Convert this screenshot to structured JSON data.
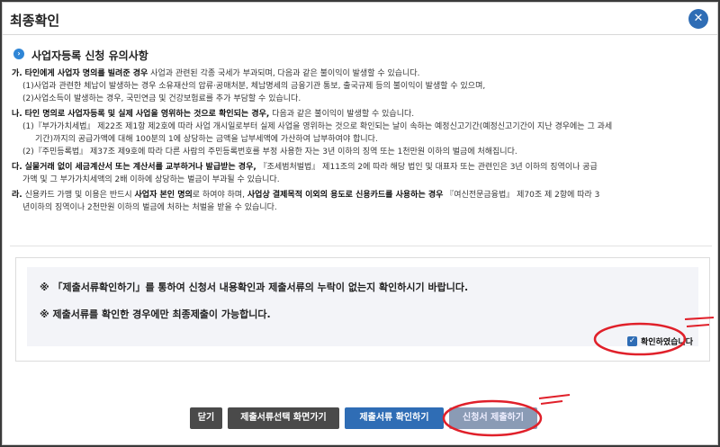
{
  "modal": {
    "title": "최종확인",
    "close_glyph": "✕"
  },
  "section": {
    "title": "사업자등록 신청 유의사항"
  },
  "items": {
    "ga": {
      "prefix": "가.",
      "lead": "타인에게 사업자 명의를 빌려준 경우",
      "rest": " 사업과 관련된 각종 국세가 부과되며, 다음과 같은 불이익이 발생할 수 있습니다.",
      "sub1": "(1)사업과 관련한 체납이 발생하는 경우 소유재산의 압류·공매처분, 체납명세의 금융기관 통보, 출국규제 등의 불이익이 발생할 수 있으며,",
      "sub2": "(2)사업소득이 발생하는 경우, 국민연금 및 건강보험료를 추가 부담할 수 있습니다."
    },
    "na": {
      "prefix": "나.",
      "lead": "타인 명의로 사업자등록 및 실제 사업을 영위하는 것으로 확인되는 경우,",
      "rest": " 다음과 같은 불이익이 발생할 수 있습니다.",
      "sub1a": "(1)『부가가치세법』 제22조 제1항 제2호에 따라 사업 개시일로부터 실제 사업을 영위하는 것으로 확인되는 날이 속하는 예정신고기간(예정신고기간이 지난 경우에는 그 과세",
      "sub1b": "기간)까지의 공급가액에 대해 100분의 1에 상당하는 금액을 납부세액에 가산하여 납부하여야 합니다.",
      "sub2": "(2)『주민등록법』 제37조 제9호에 따라 다른 사람의 주민등록번호를 부정 사용한 자는 3년 이하의 징역 또는 1천만원 이하의 벌금에 처해집니다."
    },
    "da": {
      "prefix": "다.",
      "lead": "실물거래 없이 세금계산서 또는 계산서를 교부하거나 발급받는 경우,",
      "rest": " 『조세범처벌법』 제11조의 2에 따라 해당 법인 및 대표자 또는 관련인은 3년 이하의 징역이나 공급",
      "line2": "가액 및 그 부가가치세액의 2배 이하에 상당하는 벌금이 부과될 수 있습니다."
    },
    "ra": {
      "prefix": "라.",
      "pre": "신용카드 가맹 및 이용은 반드시 ",
      "bold1": "사업자 본인 명의",
      "mid": "로 하여야 하며, ",
      "bold2": "사업상 결제목적 이외의 용도로 신용카드를 사용하는 경우",
      "rest": " 『여신전문금융법』 제70조 제 2항에 따라 3",
      "line2": "년이하의 징역이나 2천만원 이하의 벌금에 처하는 처벌을 받을 수 있습니다."
    }
  },
  "notice": {
    "line1": "※ 「제출서류확인하기」를 통하여 신청서 내용확인과 제출서류의 누락이 없는지 확인하시기 바랍니다.",
    "line2": "※ 제출서류를 확인한 경우에만 최종제출이 가능합니다.",
    "confirm_label": "확인하였습니다",
    "confirm_checked": true
  },
  "buttons": {
    "close": "닫기",
    "select_docs": "제출서류선택 화면가기",
    "check_docs": "제출서류 확인하기",
    "submit": "신청서 제출하기"
  },
  "colors": {
    "accent": "#2f6db5",
    "dark_button": "#4a4a4a",
    "annotation_red": "#e0202a"
  },
  "icons": {
    "section": "arrow-circle-icon",
    "close": "close-icon",
    "checkbox": "checkbox-checked-icon"
  }
}
